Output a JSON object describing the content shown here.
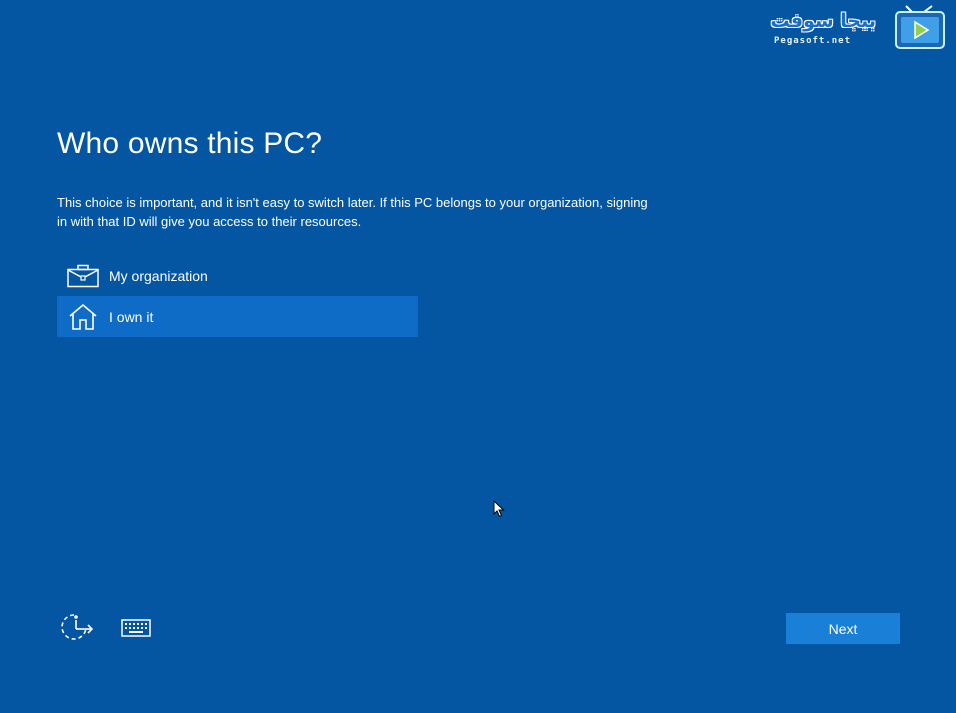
{
  "watermark": {
    "arabic_text": "بيجا سوفت",
    "site_text": "Pegasoft.net"
  },
  "page": {
    "title": "Who owns this PC?",
    "description": "This choice is important, and it isn't easy to switch later. If this PC belongs to your organization, signing in with that ID will give you access to their resources."
  },
  "options": [
    {
      "label": "My organization",
      "icon": "briefcase-icon",
      "selected": false
    },
    {
      "label": "I own it",
      "icon": "home-icon",
      "selected": true
    }
  ],
  "footer": {
    "accessibility_icon": "ease-of-access-icon",
    "keyboard_icon": "keyboard-icon",
    "next_label": "Next"
  },
  "colors": {
    "background": "#0556a2",
    "selected_option": "#0f6cc6",
    "next_button": "#1a7fd6",
    "text": "#ffffff"
  }
}
